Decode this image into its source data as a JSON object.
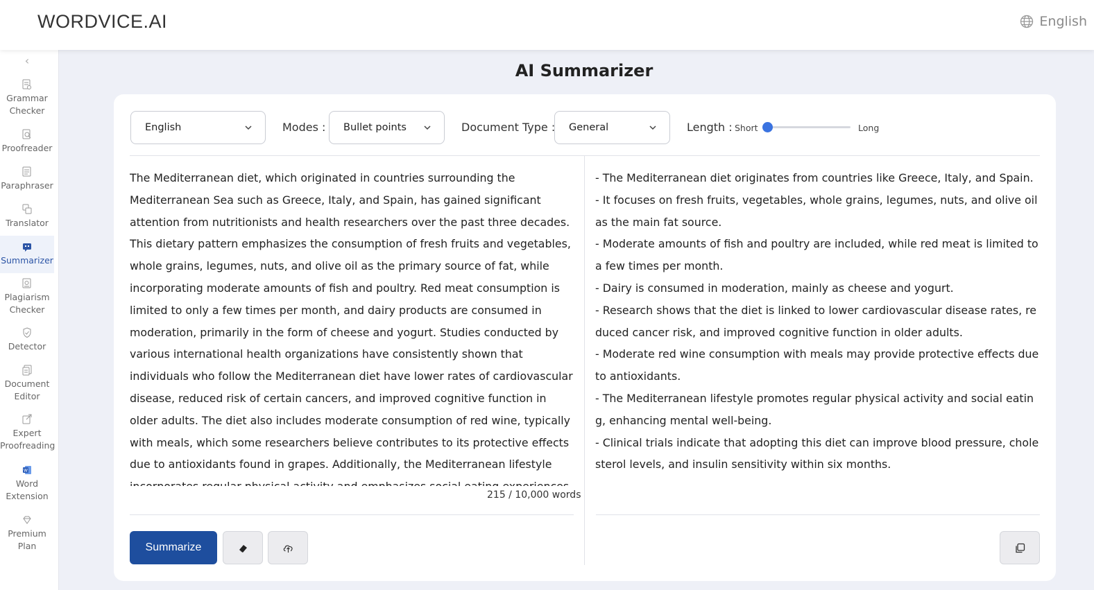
{
  "header": {
    "logo": "WORDVICE.AI",
    "language": "English",
    "language_icon": "globe-icon"
  },
  "sidebar": {
    "collapse_icon": "chevron-left-icon",
    "items": [
      {
        "label": "Grammar Checker",
        "icon": "grammar-checker-icon",
        "active": false
      },
      {
        "label": "Proofreader",
        "icon": "proofreader-icon",
        "active": false
      },
      {
        "label": "Paraphraser",
        "icon": "paraphraser-icon",
        "active": false
      },
      {
        "label": "Translator",
        "icon": "translator-icon",
        "active": false
      },
      {
        "label": "Summarizer",
        "icon": "summarizer-icon",
        "active": true
      },
      {
        "label": "Plagiarism Checker",
        "icon": "plagiarism-checker-icon",
        "active": false
      },
      {
        "label": "Detector",
        "icon": "detector-icon",
        "active": false
      },
      {
        "label": "Document Editor",
        "icon": "document-editor-icon",
        "active": false
      },
      {
        "label": "Expert Proofreading",
        "icon": "expert-proofreading-icon",
        "active": false
      },
      {
        "label": "Word Extension",
        "icon": "word-extension-icon",
        "active": false
      },
      {
        "label": "Premium Plan",
        "icon": "premium-plan-icon",
        "active": false
      }
    ]
  },
  "main": {
    "title": "AI Summarizer",
    "controls": {
      "language_value": "English",
      "modes_label": "Modes :",
      "modes_value": "Bullet points",
      "doc_type_label": "Document Type :",
      "doc_type_value": "General",
      "length_label": "Length :",
      "length_min_label": "Short",
      "length_max_label": "Long",
      "length_value": 0
    },
    "input": {
      "text": "The Mediterranean diet, which originated in countries surrounding the Mediterranean Sea such as Greece, Italy, and Spain, has gained significant attention from nutritionists and health researchers over the past three decades. This dietary pattern emphasizes the consumption of fresh fruits and vegetables, whole grains, legumes, nuts, and olive oil as the primary source of fat, while incorporating moderate amounts of fish and poultry. Red meat consumption is limited to only a few times per month, and dairy products are consumed in moderation, primarily in the form of cheese and yogurt. Studies conducted by various international health organizations have consistently shown that individuals who follow the Mediterranean diet have lower rates of cardiovascular disease, reduced risk of certain cancers, and improved cognitive function in older adults. The diet also includes moderate consumption of red wine, typically with meals, which some researchers believe contributes to its protective effects due to antioxidants found in grapes. Additionally, the Mediterranean lifestyle incorporates regular physical activity and emphasizes social eating experiences, where meals are shared with",
      "word_count": "215 / 10,000 words"
    },
    "output": {
      "bullets": [
        "- The Mediterranean diet originates from countries like Greece, Italy, and Spain.",
        "- It focuses on fresh fruits, vegetables, whole grains, legumes, nuts, and olive oil as the main fat source.",
        "- Moderate amounts of fish and poultry are included, while red meat is limited to a few times per month.",
        "- Dairy is consumed in moderation, mainly as cheese and yogurt.",
        "- Research shows that the diet is linked to lower cardiovascular disease rates, reduced cancer risk, and improved cognitive function in older adults.",
        "- Moderate red wine consumption with meals may provide protective effects due to antioxidants.",
        "- The Mediterranean lifestyle promotes regular physical activity and social eating, enhancing mental well-being.",
        "- Clinical trials indicate that adopting this diet can improve blood pressure, cholesterol levels, and insulin sensitivity within six months."
      ]
    },
    "actions": {
      "summarize_label": "Summarize",
      "clear_icon": "eraser-icon",
      "upload_icon": "cloud-upload-icon",
      "copy_icon": "copy-icon"
    }
  }
}
